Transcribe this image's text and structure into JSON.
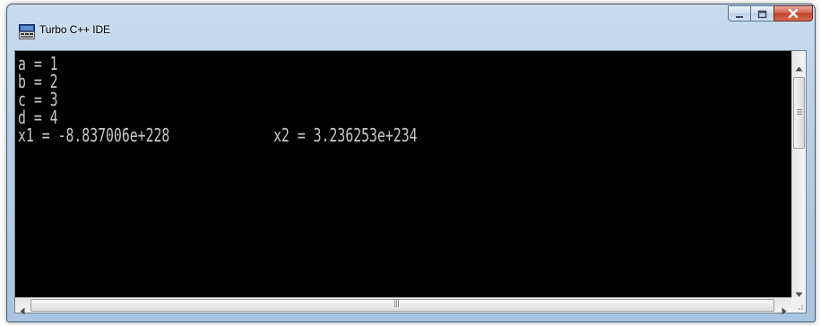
{
  "window": {
    "title": "Turbo C++ IDE",
    "icon": "turbo-cpp-app-icon",
    "controls": [
      "minimize-icon",
      "maximize-icon",
      "close-icon"
    ]
  },
  "console": {
    "lines": [
      "a = 1",
      "b = 2",
      "c = 3",
      "d = 4",
      "x1 = -8.837006e+228             x2 = 3.236253e+234"
    ],
    "text_color": "#c8c8c8",
    "background_color": "#000000"
  },
  "scrollbars": {
    "vertical_icons": [
      "scroll-up-arrow-icon",
      "scroll-down-arrow-icon"
    ],
    "horizontal_icons": [
      "scroll-left-arrow-icon",
      "scroll-right-arrow-icon"
    ],
    "thumb_grip_glyph": "|||"
  }
}
